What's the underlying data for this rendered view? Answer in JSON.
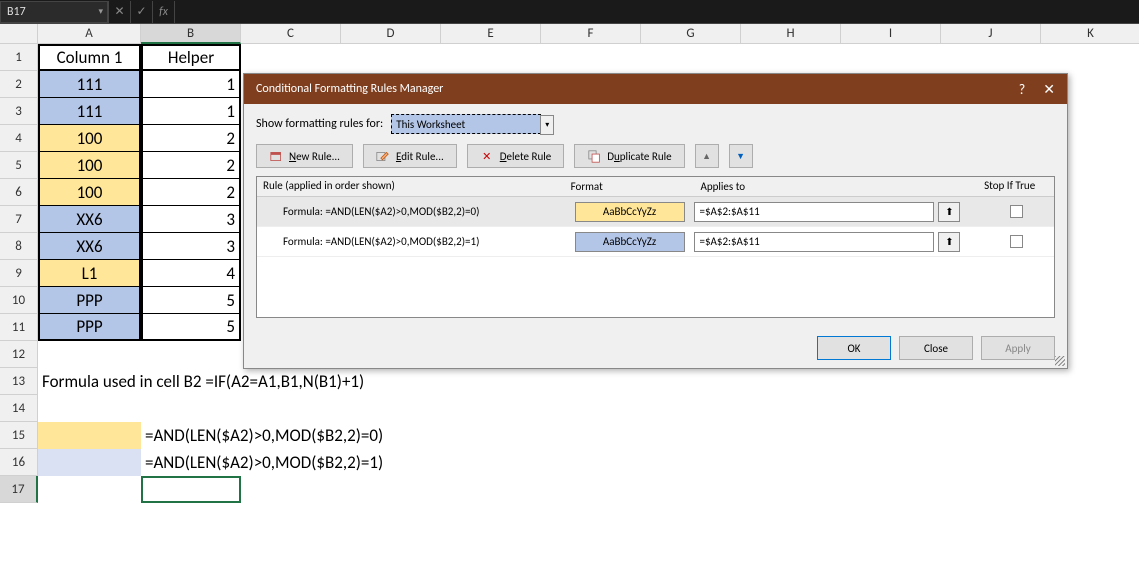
{
  "formula_bar": {
    "name_box": "B17",
    "cancel": "✕",
    "confirm": "✓",
    "fx": "fx",
    "formula": ""
  },
  "columns": [
    "A",
    "B",
    "C",
    "D",
    "E",
    "F",
    "G",
    "H",
    "I",
    "J",
    "K"
  ],
  "row_numbers": [
    "1",
    "2",
    "3",
    "4",
    "5",
    "6",
    "7",
    "8",
    "9",
    "10",
    "11",
    "12",
    "13",
    "14",
    "15",
    "16",
    "17"
  ],
  "headers": {
    "A": "Column 1",
    "B": "Helper"
  },
  "table": [
    {
      "A": "111",
      "B": "1",
      "color": "blue"
    },
    {
      "A": "111",
      "B": "1",
      "color": "blue"
    },
    {
      "A": "100",
      "B": "2",
      "color": "yellow"
    },
    {
      "A": "100",
      "B": "2",
      "color": "yellow"
    },
    {
      "A": "100",
      "B": "2",
      "color": "yellow"
    },
    {
      "A": "XX6",
      "B": "3",
      "color": "blue"
    },
    {
      "A": "XX6",
      "B": "3",
      "color": "blue"
    },
    {
      "A": "L1",
      "B": "4",
      "color": "yellow"
    },
    {
      "A": "PPP",
      "B": "5",
      "color": "blue"
    },
    {
      "A": "PPP",
      "B": "5",
      "color": "blue"
    }
  ],
  "row13": "Formula used in cell B2 =IF(A2=A1,B1,N(B1)+1)",
  "row15": "=AND(LEN($A2)>0,MOD($B2,2)=0)",
  "row16": "=AND(LEN($A2)>0,MOD($B2,2)=1)",
  "dialog": {
    "title": "Conditional Formatting Rules Manager",
    "show_for_label": "Show formatting rules for:",
    "show_for_value": "This Worksheet",
    "buttons": {
      "new": "New Rule...",
      "edit": "Edit Rule...",
      "delete": "Delete Rule",
      "duplicate": "Duplicate Rule"
    },
    "table_hdr": {
      "rule": "Rule (applied in order shown)",
      "format": "Format",
      "applies": "Applies to",
      "stop": "Stop If True"
    },
    "rules": [
      {
        "formula": "Formula: =AND(LEN($A2)>0,MOD($B2,2)=0)",
        "preview": "AaBbCcYyZz",
        "preview_bg": "#ffe699",
        "applies": "=$A$2:$A$11"
      },
      {
        "formula": "Formula: =AND(LEN($A2)>0,MOD($B2,2)=1)",
        "preview": "AaBbCcYyZz",
        "preview_bg": "#b4c6e7",
        "applies": "=$A$2:$A$11"
      }
    ],
    "footer": {
      "ok": "OK",
      "close": "Close",
      "apply": "Apply"
    }
  }
}
